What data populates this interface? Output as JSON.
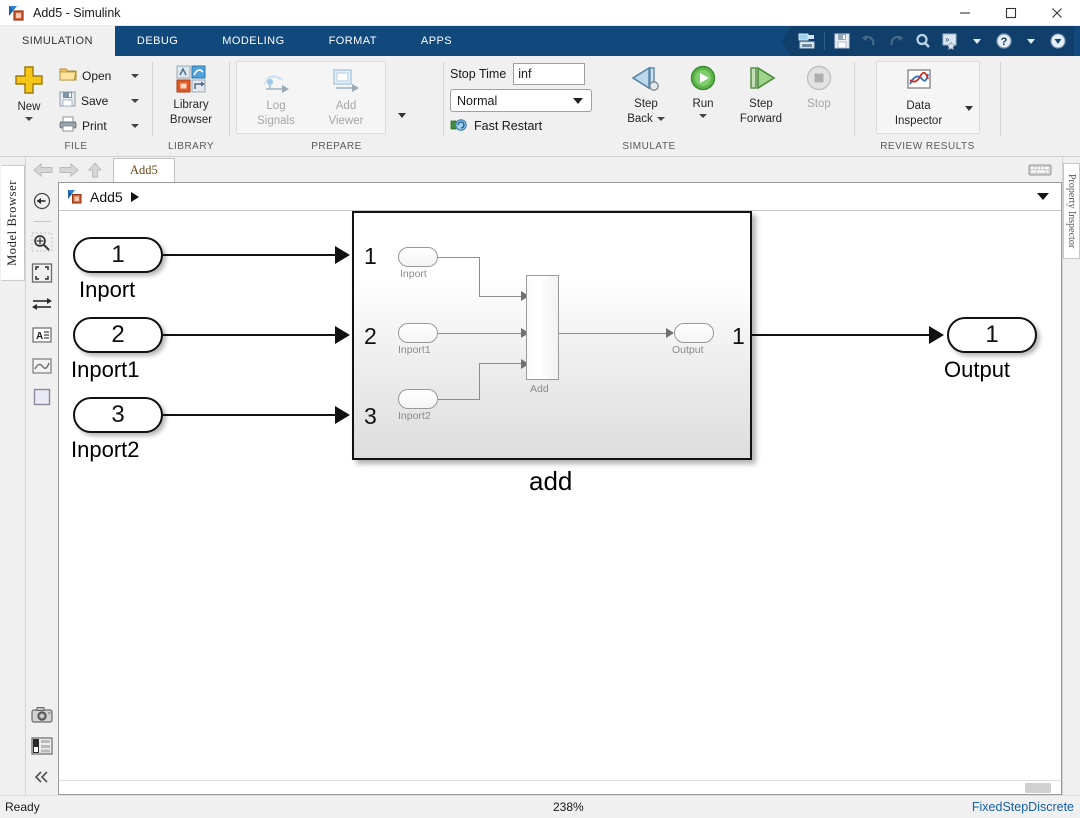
{
  "window": {
    "title": "Add5 - Simulink",
    "minimize": "─",
    "maximize": "☐",
    "close": "✕"
  },
  "ribbon_tabs": [
    {
      "label": "SIMULATION",
      "active": true
    },
    {
      "label": "DEBUG",
      "active": false
    },
    {
      "label": "MODELING",
      "active": false
    },
    {
      "label": "FORMAT",
      "active": false
    },
    {
      "label": "APPS",
      "active": false
    }
  ],
  "quick_access": [
    {
      "name": "simulink-home-icon",
      "glyph": "⌗"
    },
    {
      "name": "save-icon",
      "glyph": "ὋE"
    },
    {
      "name": "undo-icon",
      "glyph": "↶"
    },
    {
      "name": "redo-icon",
      "glyph": "↷"
    },
    {
      "name": "search-icon",
      "glyph": "ὐD"
    },
    {
      "name": "favorites-icon",
      "glyph": "»"
    },
    {
      "name": "help-icon",
      "glyph": "?"
    },
    {
      "name": "more-icon",
      "glyph": "▼"
    }
  ],
  "ribbon": {
    "file_group": {
      "title": "FILE",
      "new_label": "New",
      "open_label": "Open",
      "save_label": "Save",
      "print_label": "Print"
    },
    "library_group": {
      "title": "LIBRARY",
      "library_browser_label": "Library\nBrowser",
      "library_browser_line1": "Library",
      "library_browser_line2": "Browser"
    },
    "prepare_group": {
      "title": "PREPARE",
      "log_signals_line1": "Log",
      "log_signals_line2": "Signals",
      "add_viewer_line1": "Add",
      "add_viewer_line2": "Viewer"
    },
    "simulate_group": {
      "title": "SIMULATE",
      "stop_time_label": "Stop Time",
      "stop_time_value": "inf",
      "sim_mode_value": "Normal",
      "fast_restart_label": "Fast Restart",
      "step_back_line1": "Step",
      "step_back_line2": "Back",
      "run_label": "Run",
      "step_forward_line1": "Step",
      "step_forward_line2": "Forward",
      "stop_label": "Stop"
    },
    "review_group": {
      "title": "REVIEW RESULTS",
      "data_inspector_line1": "Data",
      "data_inspector_line2": "Inspector"
    }
  },
  "left_panel": {
    "model_browser_tab": "Model Browser"
  },
  "right_panel": {
    "property_inspector_tab": "Property Inspector",
    "collapse_label": "«"
  },
  "editor": {
    "model_tab_label": "Add5",
    "breadcrumb_label": "Add5"
  },
  "vtoolbar": [
    {
      "name": "navigate-back-icon"
    },
    {
      "name": "zoom-in-icon"
    },
    {
      "name": "fit-to-view-icon"
    },
    {
      "name": "signal-routing-icon"
    },
    {
      "name": "annotation-icon"
    },
    {
      "name": "scope-icon"
    },
    {
      "name": "blank-block-icon"
    },
    {
      "name": "camera-icon"
    },
    {
      "name": "compare-icon"
    },
    {
      "name": "collapse-icon"
    }
  ],
  "diagram": {
    "inports": [
      {
        "number": "1",
        "label": "Inport"
      },
      {
        "number": "2",
        "label": "Inport1"
      },
      {
        "number": "3",
        "label": "Inport2"
      }
    ],
    "subsystem": {
      "label": "add",
      "input_port_numbers": [
        "1",
        "2",
        "3"
      ],
      "output_port_number": "1",
      "inner_inports": [
        "Inport",
        "Inport1",
        "Inport2"
      ],
      "inner_block_label": "Add",
      "inner_outport_label": "Output"
    },
    "outport": {
      "number": "1",
      "label": "Output"
    }
  },
  "status": {
    "ready": "Ready",
    "zoom": "238%",
    "solver": "FixedStepDiscrete"
  },
  "colors": {
    "ribbon_blue": "#11497c",
    "qat_blue": "#103f6c",
    "chrome_gray": "#f0f0f0",
    "status_link": "#1560a8",
    "block_stroke": "#111111"
  }
}
